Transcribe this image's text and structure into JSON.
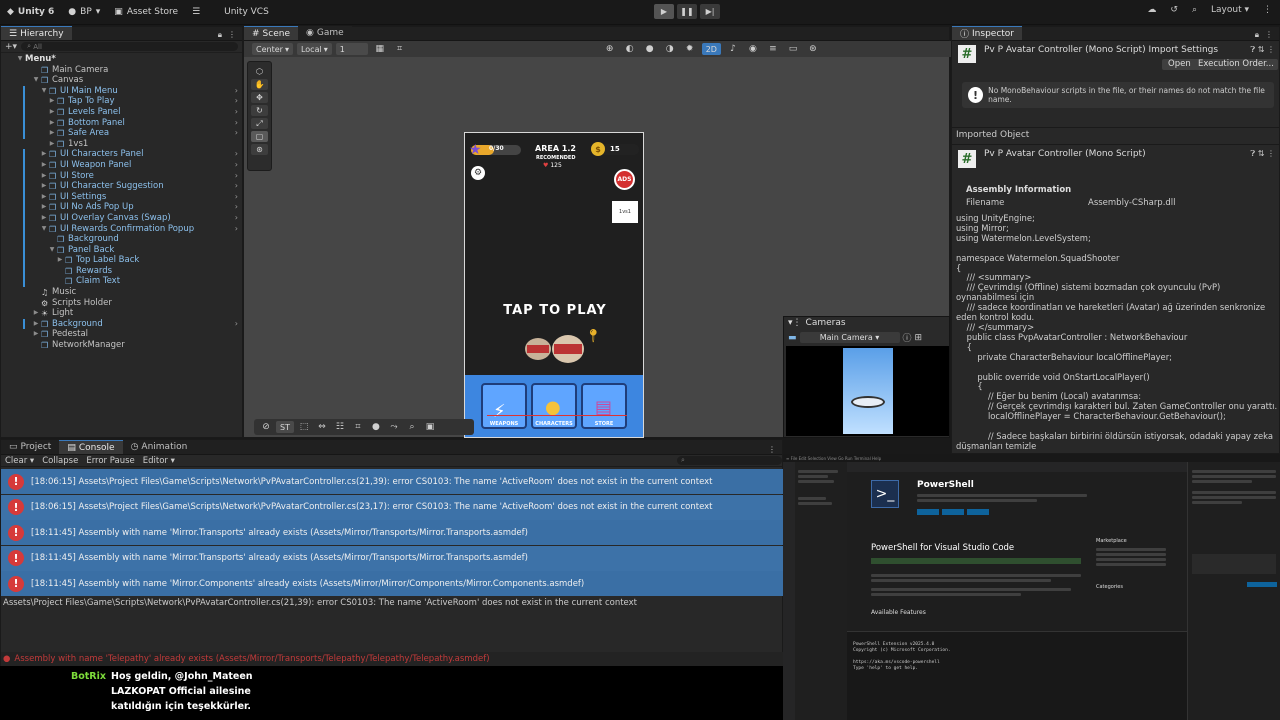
{
  "toolbar": {
    "app": "Unity 6",
    "account": "BP",
    "asset_store": "Asset Store",
    "vcs": "Unity VCS",
    "layout": "Layout"
  },
  "hierarchy": {
    "tab": "Hierarchy",
    "search_placeholder": "All",
    "rows": [
      {
        "label": "Menu*",
        "indent": 0,
        "tri": "▼",
        "icon": "",
        "bold": true,
        "chev": false
      },
      {
        "label": "Main Camera",
        "indent": 2,
        "tri": "",
        "icon": "cube",
        "bold": false,
        "chev": false
      },
      {
        "label": "Canvas",
        "indent": 2,
        "tri": "▼",
        "icon": "cube",
        "bold": false,
        "chev": false
      },
      {
        "label": "UI Main Menu",
        "indent": 3,
        "tri": "▼",
        "icon": "cube",
        "bold": false,
        "chev": true,
        "blue": true
      },
      {
        "label": "Tap To Play",
        "indent": 4,
        "tri": "▶",
        "icon": "cube",
        "bold": false,
        "chev": true,
        "blue": true
      },
      {
        "label": "Levels Panel",
        "indent": 4,
        "tri": "▶",
        "icon": "cube",
        "bold": false,
        "chev": true,
        "blue": true
      },
      {
        "label": "Bottom Panel",
        "indent": 4,
        "tri": "▶",
        "icon": "cube",
        "bold": false,
        "chev": true,
        "blue": true
      },
      {
        "label": "Safe Area",
        "indent": 4,
        "tri": "▶",
        "icon": "cube",
        "bold": false,
        "chev": true,
        "blue": true
      },
      {
        "label": "1vs1",
        "indent": 4,
        "tri": "▶",
        "icon": "cube",
        "bold": false,
        "chev": false
      },
      {
        "label": "UI Characters Panel",
        "indent": 3,
        "tri": "▶",
        "icon": "cube",
        "bold": false,
        "chev": true,
        "blue": true
      },
      {
        "label": "UI Weapon Panel",
        "indent": 3,
        "tri": "▶",
        "icon": "cube",
        "bold": false,
        "chev": true,
        "blue": true
      },
      {
        "label": "UI Store",
        "indent": 3,
        "tri": "▶",
        "icon": "cube",
        "bold": false,
        "chev": true,
        "blue": true
      },
      {
        "label": "UI Character Suggestion",
        "indent": 3,
        "tri": "▶",
        "icon": "cube",
        "bold": false,
        "chev": true,
        "blue": true
      },
      {
        "label": "UI Settings",
        "indent": 3,
        "tri": "▶",
        "icon": "cube",
        "bold": false,
        "chev": true,
        "blue": true
      },
      {
        "label": "UI No Ads Pop Up",
        "indent": 3,
        "tri": "▶",
        "icon": "cube",
        "bold": false,
        "chev": true,
        "blue": true
      },
      {
        "label": "UI Overlay Canvas (Swap)",
        "indent": 3,
        "tri": "▶",
        "icon": "cube",
        "bold": false,
        "chev": true,
        "blue": true
      },
      {
        "label": "UI Rewards Confirmation Popup",
        "indent": 3,
        "tri": "▼",
        "icon": "cube",
        "bold": false,
        "chev": true,
        "blue": true
      },
      {
        "label": "Background",
        "indent": 4,
        "tri": "",
        "icon": "cube",
        "bold": false,
        "chev": false,
        "blue": true
      },
      {
        "label": "Panel Back",
        "indent": 4,
        "tri": "▼",
        "icon": "cube",
        "bold": false,
        "chev": false,
        "blue": true
      },
      {
        "label": "Top Label Back",
        "indent": 5,
        "tri": "▶",
        "icon": "cube",
        "bold": false,
        "chev": false,
        "blue": true
      },
      {
        "label": "Rewards",
        "indent": 5,
        "tri": "",
        "icon": "cube",
        "bold": false,
        "chev": false,
        "blue": true
      },
      {
        "label": "Claim Text",
        "indent": 5,
        "tri": "",
        "icon": "cube",
        "bold": false,
        "chev": false,
        "blue": true
      },
      {
        "label": "Music",
        "indent": 2,
        "tri": "",
        "icon": "music",
        "bold": false,
        "chev": false
      },
      {
        "label": "Scripts Holder",
        "indent": 2,
        "tri": "",
        "icon": "gear",
        "bold": false,
        "chev": false
      },
      {
        "label": "Light",
        "indent": 2,
        "tri": "▶",
        "icon": "light",
        "bold": false,
        "chev": false
      },
      {
        "label": "Background",
        "indent": 2,
        "tri": "▶",
        "icon": "cube",
        "bold": false,
        "chev": true,
        "blue": true
      },
      {
        "label": "Pedestal",
        "indent": 2,
        "tri": "▶",
        "icon": "cube",
        "bold": false,
        "chev": false
      },
      {
        "label": "NetworkManager",
        "indent": 2,
        "tri": "",
        "icon": "cube",
        "bold": false,
        "chev": false
      }
    ]
  },
  "scene": {
    "tab_scene": "Scene",
    "tab_game": "Game",
    "pivot": "Center",
    "space": "Local",
    "snap": "1",
    "mode_2d": "2D",
    "st_label": "ST"
  },
  "game": {
    "area": "AREA 1.2",
    "recommended": "RECOMENDED",
    "rec_value": "125",
    "coins": "15",
    "xp": "0/30",
    "ads": "ADS",
    "side_btn": "1vs1",
    "tap": "TAP TO PLAY",
    "bottom": [
      "WEAPONS",
      "CHARACTERS",
      "STORE"
    ]
  },
  "cameras": {
    "title": "Cameras",
    "selected": "Main Camera"
  },
  "inspector": {
    "tab": "Inspector",
    "title": "Pv P Avatar Controller (Mono Script) Import Settings",
    "open": "Open",
    "exec_order": "Execution Order...",
    "warning": "No MonoBehaviour scripts in the file, or their names do not match the file name.",
    "imported_object": "Imported Object",
    "script_title": "Pv P Avatar Controller (Mono Script)",
    "assembly_info": "Assembly Information",
    "filename_label": "Filename",
    "filename_value": "Assembly-CSharp.dll",
    "code": "using UnityEngine;\nusing Mirror;\nusing Watermelon.LevelSystem;\n\nnamespace Watermelon.SquadShooter\n{\n    /// <summary>\n    /// Çevrimdışı (Offline) sistemi bozmadan çok oyunculu (PvP) oynanabilmesi için\n    /// sadece koordinatları ve hareketleri (Avatar) ağ üzerinden senkronize eden kontrol kodu.\n    /// </summary>\n    public class PvpAvatarController : NetworkBehaviour\n    {\n        private CharacterBehaviour localOfflinePlayer;\n\n        public override void OnStartLocalPlayer()\n        {\n            // Eğer bu benim (Local) avatarımsa:\n            // Gerçek çevrimdışı karakteri bul. Zaten GameController onu yarattı.\n            localOfflinePlayer = CharacterBehaviour.GetBehaviour();\n\n            // Sadece başkaları birbirini öldürsün istiyorsak, odadaki yapay zeka düşmanları temizle\n            if (PvPState.IsPvPMode && ActiveRoom.CurrentLevelData != null)\n            {"
  },
  "console": {
    "tabs": [
      "Project",
      "Console",
      "Animation"
    ],
    "clear": "Clear",
    "collapse": "Collapse",
    "error_pause": "Error Pause",
    "editor": "Editor",
    "messages": [
      "[18:06:15] Assets\\Project Files\\Game\\Scripts\\Network\\PvPAvatarController.cs(21,39): error CS0103: The name 'ActiveRoom' does not exist in the current context",
      "[18:06:15] Assets\\Project Files\\Game\\Scripts\\Network\\PvPAvatarController.cs(23,17): error CS0103: The name 'ActiveRoom' does not exist in the current context",
      "[18:11:45] Assembly with name 'Mirror.Transports' already exists (Assets/Mirror/Transports/Mirror.Transports.asmdef)",
      "[18:11:45] Assembly with name 'Mirror.Transports' already exists (Assets/Mirror/Transports/Mirror.Transports.asmdef)",
      "[18:11:45] Assembly with name 'Mirror.Components' already exists (Assets/Mirror/Mirror/Components/Mirror.Components.asmdef)"
    ],
    "detail": "Assets\\Project Files\\Game\\Scripts\\Network\\PvPAvatarController.cs(21,39): error CS0103: The name 'ActiveRoom' does not exist in the current context",
    "status": "Assembly with name 'Telepathy' already exists (Assets/Mirror/Transports/Telepathy/Telepathy/Telepathy.asmdef)"
  },
  "stream_chat": {
    "user": "BotRix",
    "line1": "Hoş geldin, @John_Mateen",
    "line2": "LAZKOPAT Official ailesine",
    "line3": "katıldığın için teşekkürler."
  },
  "vscode": {
    "ext_title": "PowerShell",
    "ext_heading": "PowerShell for Visual Studio Code",
    "features": "Available Features",
    "marketplace": "Marketplace",
    "categories": "Categories",
    "terminal_lines": [
      "PowerShell Extension v2025.4.0",
      "Copyright (c) Microsoft Corporation.",
      "",
      "https://aka.ms/vscode-powershell",
      "Type 'help' to get help."
    ]
  },
  "colors": {
    "accent": "#3a79bb",
    "error": "#d63a3a",
    "console_row": "#3a6fa5"
  }
}
